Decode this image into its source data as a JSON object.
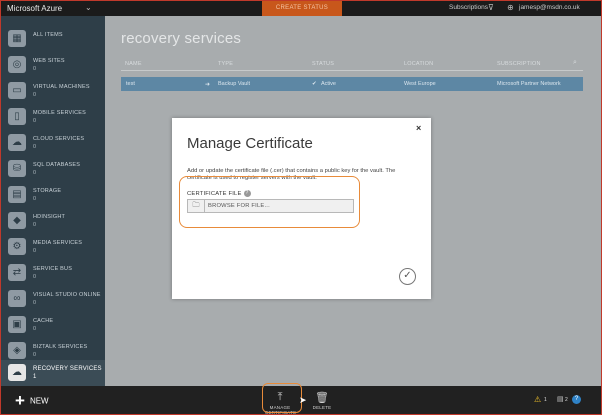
{
  "topbar": {
    "brand": "Microsoft Azure",
    "status": "CREATE STATUS",
    "subscriptions_label": "Subscriptions",
    "user": "jamesp@msdn.co.uk"
  },
  "sidebar": {
    "items": [
      {
        "label": "ALL ITEMS",
        "count": "",
        "icon": "grid-icon"
      },
      {
        "label": "WEB SITES",
        "count": "0",
        "icon": "globe-icon"
      },
      {
        "label": "VIRTUAL MACHINES",
        "count": "0",
        "icon": "monitor-icon"
      },
      {
        "label": "MOBILE SERVICES",
        "count": "0",
        "icon": "mobile-icon"
      },
      {
        "label": "CLOUD SERVICES",
        "count": "0",
        "icon": "cloud-icon"
      },
      {
        "label": "SQL DATABASES",
        "count": "0",
        "icon": "database-icon"
      },
      {
        "label": "STORAGE",
        "count": "0",
        "icon": "storage-icon"
      },
      {
        "label": "HDINSIGHT",
        "count": "0",
        "icon": "elephant-icon"
      },
      {
        "label": "MEDIA SERVICES",
        "count": "0",
        "icon": "media-icon"
      },
      {
        "label": "SERVICE BUS",
        "count": "0",
        "icon": "bus-icon"
      },
      {
        "label": "VISUAL STUDIO ONLINE",
        "count": "0",
        "icon": "visual-studio-icon"
      },
      {
        "label": "CACHE",
        "count": "0",
        "icon": "cache-icon"
      },
      {
        "label": "BIZTALK SERVICES",
        "count": "0",
        "icon": "biztalk-icon"
      },
      {
        "label": "RECOVERY SERVICES",
        "count": "1",
        "icon": "recovery-cloud-icon"
      }
    ]
  },
  "main": {
    "title": "recovery services",
    "columns": [
      "NAME",
      "TYPE",
      "STATUS",
      "LOCATION",
      "SUBSCRIPTION"
    ],
    "row": {
      "name": "test",
      "type": "Backup Vault",
      "status": "Active",
      "location": "West Europe",
      "subscription": "Microsoft Partner Network"
    }
  },
  "dialog": {
    "title": "Manage Certificate",
    "description": "Add or update the certificate file (.cer) that contains a public key for the vault. The certificate is used to register servers with the vault.",
    "field_label": "CERTIFICATE FILE",
    "help": "?",
    "browse_placeholder": "BROWSE FOR FILE...",
    "close": "×",
    "ok": "✓"
  },
  "bottombar": {
    "new_label": "NEW",
    "commands": [
      {
        "label": "MANAGE CERTIFICATE",
        "icon": "upload-icon"
      },
      {
        "label": "DELETE",
        "icon": "trash-icon"
      }
    ],
    "warning_count": "1",
    "notification_count": "2",
    "help": "?"
  },
  "colors": {
    "accent_orange": "#e88b3a",
    "status_orange": "#c8571b",
    "sidebar": "#2e3e48",
    "selected_row": "#5d87a4",
    "help_blue": "#2f82c6"
  }
}
